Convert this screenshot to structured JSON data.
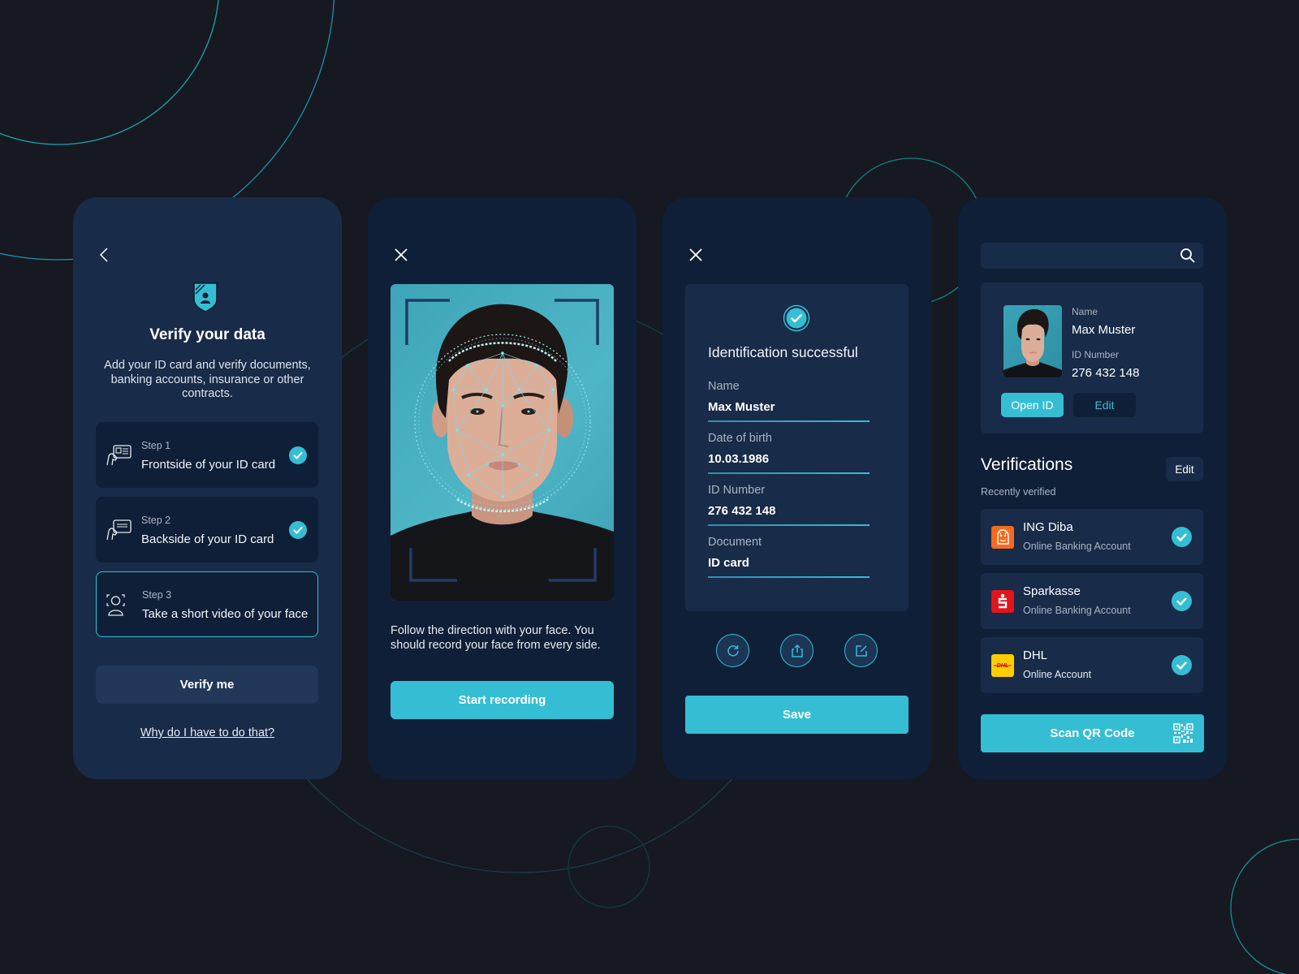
{
  "colors": {
    "background": "#161922",
    "accent": "#35bed3",
    "panel_dark": "#0f1f37",
    "panel_light": "#182b48"
  },
  "screen1": {
    "back_icon": "chevron-left-icon",
    "shield_icon": "shield-user-icon",
    "title": "Verify your data",
    "description": "Add your ID card and verify documents, banking accounts, insurance or other contracts.",
    "steps": [
      {
        "label": "Step 1",
        "text": "Frontside of your ID card",
        "icon": "hand-id-card-front-icon",
        "completed": true,
        "active": false
      },
      {
        "label": "Step 2",
        "text": "Backside of your ID card",
        "icon": "hand-id-card-back-icon",
        "completed": true,
        "active": false
      },
      {
        "label": "Step 3",
        "text": "Take a short video of your face",
        "icon": "face-scan-icon",
        "completed": false,
        "active": true
      }
    ],
    "verify_button": "Verify me",
    "why_link": "Why do I have to do that?"
  },
  "screen2": {
    "close_icon": "close-icon",
    "instruction": "Follow the direction with your face. You should record your face from every side.",
    "start_button": "Start recording"
  },
  "screen3": {
    "close_icon": "close-icon",
    "title": "Identification successful",
    "fields": [
      {
        "label": "Name",
        "value": "Max Muster"
      },
      {
        "label": "Date of birth",
        "value": "10.03.1986"
      },
      {
        "label": "ID Number",
        "value": "276 432 148"
      },
      {
        "label": "Document",
        "value": "ID card"
      }
    ],
    "actions": [
      "refresh-icon",
      "share-icon",
      "edit-icon"
    ],
    "save_button": "Save"
  },
  "screen4": {
    "search": {
      "placeholder": "",
      "value": ""
    },
    "id_card": {
      "name_label": "Name",
      "name_value": "Max Muster",
      "id_label": "ID Number",
      "id_value": "276 432 148",
      "open_button": "Open ID",
      "edit_button": "Edit"
    },
    "verifications_title": "Verifications",
    "verifications_edit": "Edit",
    "recently_label": "Recently verified",
    "verifications": [
      {
        "name": "ING Diba",
        "type": "Online Banking Account",
        "logo": "ing-lion-logo",
        "logo_color": "#f46b1f",
        "verified": true
      },
      {
        "name": "Sparkasse",
        "type": "Online Banking Account",
        "logo": "sparkasse-logo",
        "logo_color": "#e2141c",
        "verified": true
      },
      {
        "name": "DHL",
        "type": "Online Account",
        "logo": "dhl-logo",
        "logo_color": "#ffcc00",
        "verified": true
      }
    ],
    "scan_button": "Scan QR Code"
  }
}
